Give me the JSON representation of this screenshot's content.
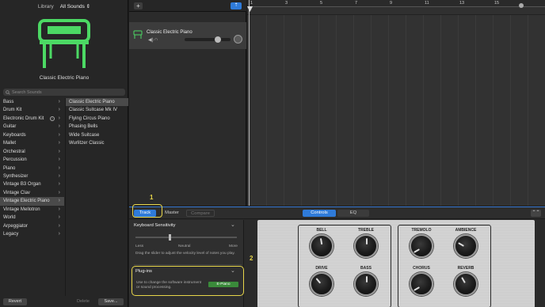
{
  "library": {
    "title": "Library",
    "filter": "All Sounds ⇕",
    "instrument_name": "Classic Electric Piano",
    "search_placeholder": "Search Sounds",
    "categories": [
      {
        "label": "Bass"
      },
      {
        "label": "Drum Kit"
      },
      {
        "label": "Electronic Drum Kit"
      },
      {
        "label": "Guitar"
      },
      {
        "label": "Keyboards"
      },
      {
        "label": "Mallet"
      },
      {
        "label": "Orchestral"
      },
      {
        "label": "Percussion"
      },
      {
        "label": "Piano"
      },
      {
        "label": "Synthesizer"
      },
      {
        "label": "Vintage B3 Organ"
      },
      {
        "label": "Vintage Clav"
      },
      {
        "label": "Vintage Electric Piano"
      },
      {
        "label": "Vintage Mellotron"
      },
      {
        "label": "World"
      },
      {
        "label": "Arpeggiator"
      },
      {
        "label": "Legacy"
      }
    ],
    "selected_category": "Vintage Electric Piano",
    "presets": [
      {
        "label": "Classic Electric Piano"
      },
      {
        "label": "Classic Suitcase Mk IV"
      },
      {
        "label": "Flying Circus Piano"
      },
      {
        "label": "Phasing Bells"
      },
      {
        "label": "Wide Suitcase"
      },
      {
        "label": "Wurlitzer Classic"
      }
    ],
    "selected_preset": "Classic Electric Piano",
    "revert_label": "Revert",
    "delete_label": "Delete",
    "save_label": "Save..."
  },
  "tracks": {
    "add_label": "+",
    "track_name": "Classic Electric Piano",
    "volume_level": 0.72
  },
  "timeline": {
    "bar_numbers": [
      "1",
      "3",
      "5",
      "7",
      "9",
      "11",
      "13",
      "15"
    ]
  },
  "smart_controls": {
    "tabs": {
      "track": "Track",
      "master": "Master",
      "compare": "Compare",
      "controls": "Controls",
      "eq": "EQ"
    },
    "callout_1": "1",
    "callout_2": "2",
    "keyboard_sensitivity": {
      "title": "Keyboard Sensitivity",
      "less": "Less",
      "neutral": "Neutral",
      "more": "More",
      "value": 0.33,
      "description": "Drag the slider to adjust the velocity level of notes you play."
    },
    "plugins": {
      "title": "Plug-ins",
      "description": "Use to change the software instrument or sound processing.",
      "slot": "E-Piano"
    },
    "knobs": {
      "bell": "BELL",
      "treble": "TREBLE",
      "drive": "DRIVE",
      "bass": "BASS",
      "tremolo": "TREMOLO",
      "ambience": "AMBIENCE",
      "chorus": "CHORUS",
      "reverb": "REVERB"
    }
  },
  "colors": {
    "accent": "#2f7bd9",
    "highlight": "#e8d64a",
    "instrument_green": "#4cd964",
    "plugin_green": "#3a8a3a"
  }
}
